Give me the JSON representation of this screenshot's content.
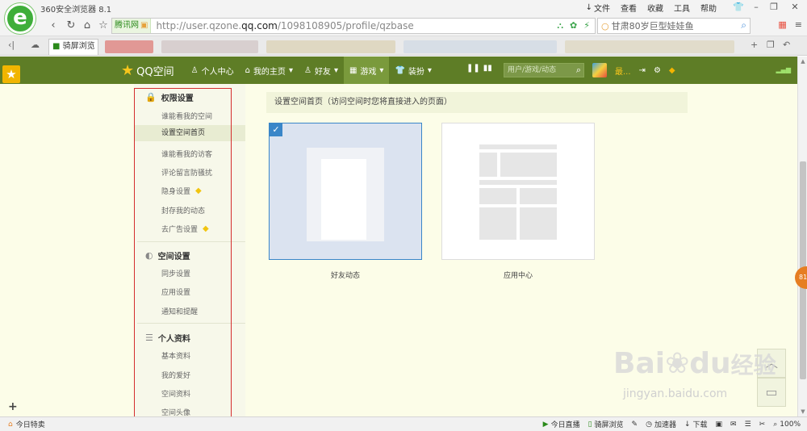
{
  "browser": {
    "title": "360安全浏览器 8.1",
    "menu": [
      "文件",
      "查看",
      "收藏",
      "工具",
      "帮助"
    ],
    "window_controls": [
      "shirt-icon",
      "minimize-icon",
      "maximize-icon",
      "close-icon"
    ],
    "address": {
      "site_tag": "腾讯网",
      "url_prefix": "http://user.qzone.",
      "url_domain": "qq.com",
      "url_suffix": "/1098108905/profile/qzbase"
    },
    "search": {
      "value": "甘肃80岁巨型娃娃鱼"
    },
    "active_tab": "骑屏浏览"
  },
  "qzone": {
    "logo": "QQ空间",
    "nav": [
      {
        "label": "个人中心",
        "icon": "user-icon"
      },
      {
        "label": "我的主页",
        "icon": "home-icon",
        "dropdown": "▾"
      },
      {
        "label": "好友",
        "icon": "friends-icon",
        "dropdown": "▾"
      },
      {
        "label": "游戏",
        "icon": "grid-icon",
        "dropdown": "▾"
      },
      {
        "label": "装扮",
        "icon": "shirt-icon",
        "dropdown": "▾"
      }
    ],
    "search_placeholder": "用户/游戏/动态",
    "username": "最...",
    "accent": "#5e7d26"
  },
  "sidebar": {
    "sections": [
      {
        "title": "权限设置",
        "items": [
          "谁能看我的空间",
          "设置空间首页",
          "谁能看我的访客",
          "评论留言防骚扰",
          "隐身设置",
          "封存我的动态",
          "去广告设置"
        ]
      },
      {
        "title": "空间设置",
        "items": [
          "同步设置",
          "应用设置",
          "通知和提醒"
        ]
      },
      {
        "title": "个人资料",
        "items": [
          "基本资料",
          "我的爱好",
          "空间资料",
          "空间头像"
        ]
      }
    ]
  },
  "main": {
    "header": "设置空间首页（访问空间时您将直接进入的页面）",
    "options": [
      {
        "label": "好友动态",
        "selected": true
      },
      {
        "label": "应用中心",
        "selected": false
      }
    ]
  },
  "statusbar": {
    "left": "今日特卖",
    "right": [
      "今日直播",
      "骑屏浏览",
      "加速器",
      "下载",
      "100%"
    ]
  },
  "watermark": {
    "main": "Bai",
    "accent": "du",
    "cn": "经验",
    "sub": "jingyan.baidu.com"
  }
}
